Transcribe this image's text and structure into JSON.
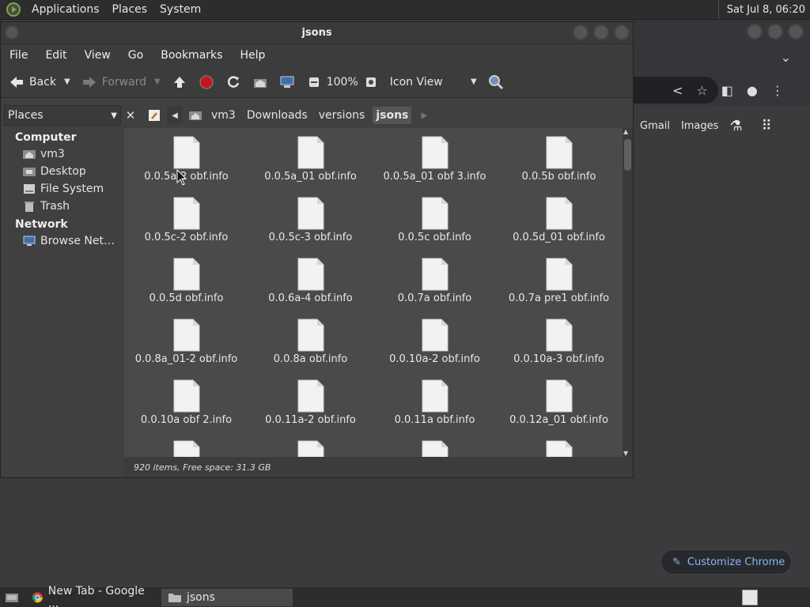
{
  "top_panel": {
    "menus": [
      "Applications",
      "Places",
      "System"
    ],
    "clock": "Sat Jul  8, 06:20"
  },
  "chrome": {
    "links": {
      "gmail": "Gmail",
      "images": "Images"
    },
    "customize_label": "Customize Chrome"
  },
  "file_manager": {
    "title": "jsons",
    "menus": [
      "File",
      "Edit",
      "View",
      "Go",
      "Bookmarks",
      "Help"
    ],
    "toolbar": {
      "back": "Back",
      "forward": "Forward",
      "zoom": "100%",
      "view_mode": "Icon View"
    },
    "places_selector": "Places",
    "breadcrumbs": [
      "vm3",
      "Downloads",
      "versions",
      "jsons"
    ],
    "sidebar": {
      "computer_heading": "Computer",
      "computer_items": [
        "vm3",
        "Desktop",
        "File System",
        "Trash"
      ],
      "network_heading": "Network",
      "network_items": [
        "Browse Net…"
      ]
    },
    "files": [
      "0.0.5a-2 obf.info",
      "0.0.5a_01 obf.info",
      "0.0.5a_01 obf 3.info",
      "0.0.5b obf.info",
      "0.0.5c-2 obf.info",
      "0.0.5c-3 obf.info",
      "0.0.5c obf.info",
      "0.0.5d_01 obf.info",
      "0.0.5d obf.info",
      "0.0.6a-4 obf.info",
      "0.0.7a obf.info",
      "0.0.7a pre1 obf.info",
      "0.0.8a_01-2 obf.info",
      "0.0.8a obf.info",
      "0.0.10a-2 obf.info",
      "0.0.10a-3 obf.info",
      "0.0.10a obf 2.info",
      "0.0.11a-2 obf.info",
      "0.0.11a obf.info",
      "0.0.12a_01 obf.info",
      "",
      "",
      "",
      ""
    ],
    "status": "920 items, Free space: 31.3 GB"
  },
  "taskbar": {
    "tasks": [
      "New Tab - Google ...",
      "jsons"
    ]
  }
}
